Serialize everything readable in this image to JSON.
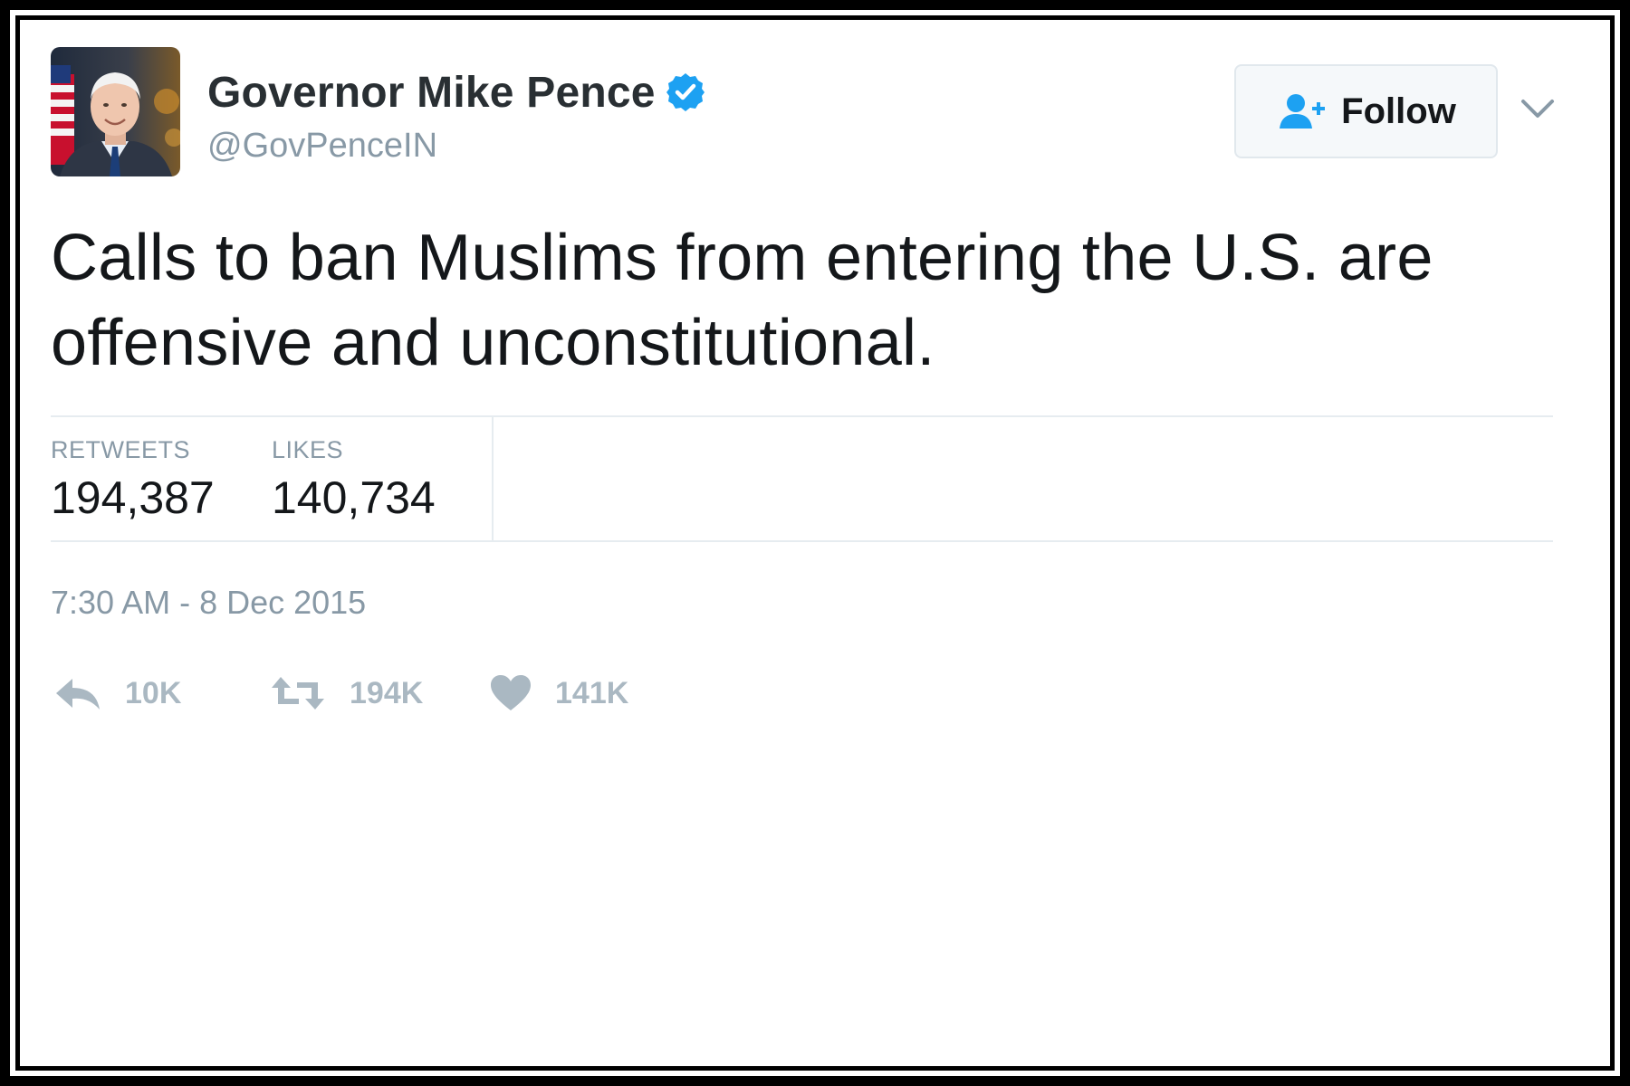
{
  "author": {
    "display_name": "Governor Mike Pence",
    "handle": "@GovPenceIN",
    "verified": true
  },
  "header": {
    "follow_label": "Follow"
  },
  "tweet": {
    "text": "Calls to ban Muslims from entering the U.S. are offensive and unconstitutional.",
    "timestamp": "7:30 AM - 8 Dec 2015"
  },
  "stats": {
    "retweets_label": "RETWEETS",
    "retweets_value": "194,387",
    "likes_label": "LIKES",
    "likes_value": "140,734"
  },
  "actions": {
    "reply_count": "10K",
    "retweet_count": "194K",
    "like_count": "141K"
  },
  "icons": {
    "verified": "verified-badge-icon",
    "follow": "add-user-icon",
    "menu": "chevron-down-icon",
    "reply": "reply-icon",
    "retweet": "retweet-icon",
    "like": "heart-icon"
  },
  "colors": {
    "verified_blue": "#1da1f2",
    "follow_icon_blue": "#1da1f2",
    "text_primary": "#14171a",
    "text_secondary": "#8899a6",
    "action_gray": "#aab8c2"
  }
}
